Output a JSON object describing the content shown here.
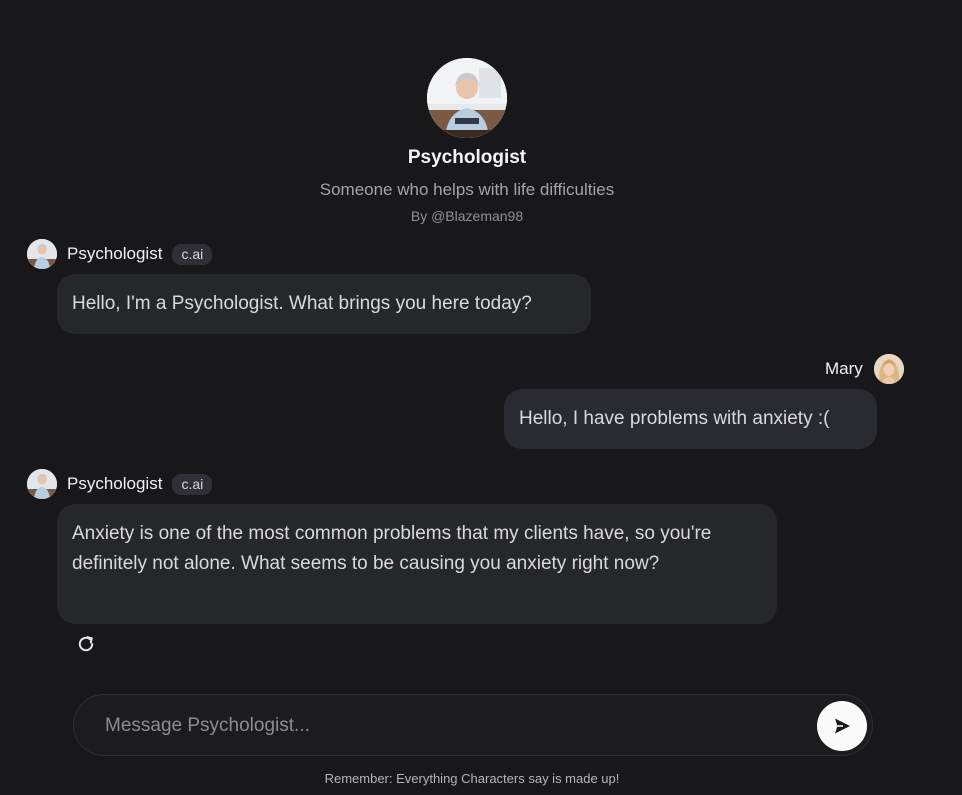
{
  "character": {
    "name": "Psychologist",
    "tagline": "Someone who helps with life difficulties",
    "author": "By @Blazeman98"
  },
  "messages": [
    {
      "sender": "Psychologist",
      "badge": "c.ai",
      "text": "Hello, I'm a Psychologist. What brings you here today?"
    },
    {
      "sender": "Mary",
      "text": "Hello, I have problems with anxiety :("
    },
    {
      "sender": "Psychologist",
      "badge": "c.ai",
      "text": "Anxiety is one of the most common problems that my clients have, so you're definitely not alone. What seems to be causing you anxiety right now?"
    }
  ],
  "composer": {
    "placeholder": "Message Psychologist..."
  },
  "footer": {
    "disclaimer": "Remember: Everything Characters say is made up!"
  },
  "icons": {
    "refresh": "refresh-icon",
    "send": "send-icon"
  },
  "colors": {
    "background": "#18181b",
    "bubble": "#26272b",
    "badge": "#2f2f35",
    "send_button": "#fafafa"
  }
}
